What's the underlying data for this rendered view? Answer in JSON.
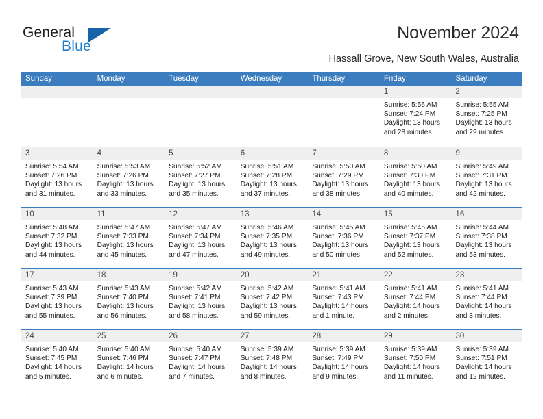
{
  "brand": {
    "name_part1": "General",
    "name_part2": "Blue",
    "accent_color": "#1763a8",
    "text_blue": "#1b7fd1"
  },
  "header": {
    "month_title": "November 2024",
    "location": "Hassall Grove, New South Wales, Australia"
  },
  "theme": {
    "header_blue": "#3b7dbf",
    "daynum_strip": "#efefef",
    "cell_background": "#ffffff",
    "text": "#1d1d1d"
  },
  "calendar": {
    "weekday_headers": [
      "Sunday",
      "Monday",
      "Tuesday",
      "Wednesday",
      "Thursday",
      "Friday",
      "Saturday"
    ],
    "weeks": [
      [
        {
          "day": "",
          "lines": []
        },
        {
          "day": "",
          "lines": []
        },
        {
          "day": "",
          "lines": []
        },
        {
          "day": "",
          "lines": []
        },
        {
          "day": "",
          "lines": []
        },
        {
          "day": "1",
          "lines": [
            "Sunrise: 5:56 AM",
            "Sunset: 7:24 PM",
            "Daylight: 13 hours",
            "and 28 minutes."
          ]
        },
        {
          "day": "2",
          "lines": [
            "Sunrise: 5:55 AM",
            "Sunset: 7:25 PM",
            "Daylight: 13 hours",
            "and 29 minutes."
          ]
        }
      ],
      [
        {
          "day": "3",
          "lines": [
            "Sunrise: 5:54 AM",
            "Sunset: 7:26 PM",
            "Daylight: 13 hours",
            "and 31 minutes."
          ]
        },
        {
          "day": "4",
          "lines": [
            "Sunrise: 5:53 AM",
            "Sunset: 7:26 PM",
            "Daylight: 13 hours",
            "and 33 minutes."
          ]
        },
        {
          "day": "5",
          "lines": [
            "Sunrise: 5:52 AM",
            "Sunset: 7:27 PM",
            "Daylight: 13 hours",
            "and 35 minutes."
          ]
        },
        {
          "day": "6",
          "lines": [
            "Sunrise: 5:51 AM",
            "Sunset: 7:28 PM",
            "Daylight: 13 hours",
            "and 37 minutes."
          ]
        },
        {
          "day": "7",
          "lines": [
            "Sunrise: 5:50 AM",
            "Sunset: 7:29 PM",
            "Daylight: 13 hours",
            "and 38 minutes."
          ]
        },
        {
          "day": "8",
          "lines": [
            "Sunrise: 5:50 AM",
            "Sunset: 7:30 PM",
            "Daylight: 13 hours",
            "and 40 minutes."
          ]
        },
        {
          "day": "9",
          "lines": [
            "Sunrise: 5:49 AM",
            "Sunset: 7:31 PM",
            "Daylight: 13 hours",
            "and 42 minutes."
          ]
        }
      ],
      [
        {
          "day": "10",
          "lines": [
            "Sunrise: 5:48 AM",
            "Sunset: 7:32 PM",
            "Daylight: 13 hours",
            "and 44 minutes."
          ]
        },
        {
          "day": "11",
          "lines": [
            "Sunrise: 5:47 AM",
            "Sunset: 7:33 PM",
            "Daylight: 13 hours",
            "and 45 minutes."
          ]
        },
        {
          "day": "12",
          "lines": [
            "Sunrise: 5:47 AM",
            "Sunset: 7:34 PM",
            "Daylight: 13 hours",
            "and 47 minutes."
          ]
        },
        {
          "day": "13",
          "lines": [
            "Sunrise: 5:46 AM",
            "Sunset: 7:35 PM",
            "Daylight: 13 hours",
            "and 49 minutes."
          ]
        },
        {
          "day": "14",
          "lines": [
            "Sunrise: 5:45 AM",
            "Sunset: 7:36 PM",
            "Daylight: 13 hours",
            "and 50 minutes."
          ]
        },
        {
          "day": "15",
          "lines": [
            "Sunrise: 5:45 AM",
            "Sunset: 7:37 PM",
            "Daylight: 13 hours",
            "and 52 minutes."
          ]
        },
        {
          "day": "16",
          "lines": [
            "Sunrise: 5:44 AM",
            "Sunset: 7:38 PM",
            "Daylight: 13 hours",
            "and 53 minutes."
          ]
        }
      ],
      [
        {
          "day": "17",
          "lines": [
            "Sunrise: 5:43 AM",
            "Sunset: 7:39 PM",
            "Daylight: 13 hours",
            "and 55 minutes."
          ]
        },
        {
          "day": "18",
          "lines": [
            "Sunrise: 5:43 AM",
            "Sunset: 7:40 PM",
            "Daylight: 13 hours",
            "and 56 minutes."
          ]
        },
        {
          "day": "19",
          "lines": [
            "Sunrise: 5:42 AM",
            "Sunset: 7:41 PM",
            "Daylight: 13 hours",
            "and 58 minutes."
          ]
        },
        {
          "day": "20",
          "lines": [
            "Sunrise: 5:42 AM",
            "Sunset: 7:42 PM",
            "Daylight: 13 hours",
            "and 59 minutes."
          ]
        },
        {
          "day": "21",
          "lines": [
            "Sunrise: 5:41 AM",
            "Sunset: 7:43 PM",
            "Daylight: 14 hours",
            "and 1 minute."
          ]
        },
        {
          "day": "22",
          "lines": [
            "Sunrise: 5:41 AM",
            "Sunset: 7:44 PM",
            "Daylight: 14 hours",
            "and 2 minutes."
          ]
        },
        {
          "day": "23",
          "lines": [
            "Sunrise: 5:41 AM",
            "Sunset: 7:44 PM",
            "Daylight: 14 hours",
            "and 3 minutes."
          ]
        }
      ],
      [
        {
          "day": "24",
          "lines": [
            "Sunrise: 5:40 AM",
            "Sunset: 7:45 PM",
            "Daylight: 14 hours",
            "and 5 minutes."
          ]
        },
        {
          "day": "25",
          "lines": [
            "Sunrise: 5:40 AM",
            "Sunset: 7:46 PM",
            "Daylight: 14 hours",
            "and 6 minutes."
          ]
        },
        {
          "day": "26",
          "lines": [
            "Sunrise: 5:40 AM",
            "Sunset: 7:47 PM",
            "Daylight: 14 hours",
            "and 7 minutes."
          ]
        },
        {
          "day": "27",
          "lines": [
            "Sunrise: 5:39 AM",
            "Sunset: 7:48 PM",
            "Daylight: 14 hours",
            "and 8 minutes."
          ]
        },
        {
          "day": "28",
          "lines": [
            "Sunrise: 5:39 AM",
            "Sunset: 7:49 PM",
            "Daylight: 14 hours",
            "and 9 minutes."
          ]
        },
        {
          "day": "29",
          "lines": [
            "Sunrise: 5:39 AM",
            "Sunset: 7:50 PM",
            "Daylight: 14 hours",
            "and 11 minutes."
          ]
        },
        {
          "day": "30",
          "lines": [
            "Sunrise: 5:39 AM",
            "Sunset: 7:51 PM",
            "Daylight: 14 hours",
            "and 12 minutes."
          ]
        }
      ]
    ]
  }
}
